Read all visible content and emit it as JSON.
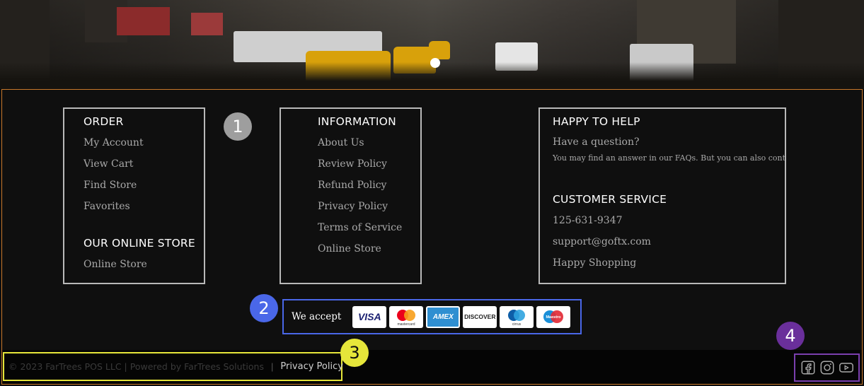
{
  "footer": {
    "order": {
      "title": "ORDER",
      "items": [
        "My Account",
        "View Cart",
        "Find Store",
        "Favorites"
      ]
    },
    "online_store": {
      "title": "OUR ONLINE STORE",
      "items": [
        "Online Store"
      ]
    },
    "information": {
      "title": "INFORMATION",
      "items": [
        "About Us",
        "Review Policy",
        "Refund Policy",
        "Privacy Policy",
        "Terms of Service",
        "Online Store"
      ]
    },
    "help": {
      "title": "HAPPY TO HELP",
      "question": "Have a question?",
      "note": "You may find an answer in our FAQs. But you can also contact us:"
    },
    "customer_service": {
      "title": "CUSTOMER SERVICE",
      "phone": "125-631-9347",
      "email": "support@goftx.com",
      "tagline": "Happy Shopping"
    },
    "payments": {
      "label": "We accept",
      "cards": [
        "VISA",
        "mastercard",
        "AMEX",
        "DISCOVER",
        "cirrus",
        "Maestro"
      ]
    },
    "bottom": {
      "copyright": "© 2023 FarTrees POS LLC | Powered by FarTrees Solutions",
      "privacy_link": "Privacy Policy"
    },
    "social": [
      "facebook-icon",
      "instagram-icon",
      "youtube-icon"
    ]
  },
  "annotations": [
    "1",
    "2",
    "3",
    "4"
  ],
  "colors": {
    "annotation_1": "#9e9e9e",
    "annotation_2": "#4a67e8",
    "annotation_3": "#e6e63a",
    "annotation_4": "#6a2f9b",
    "frame": "#c8782a"
  }
}
